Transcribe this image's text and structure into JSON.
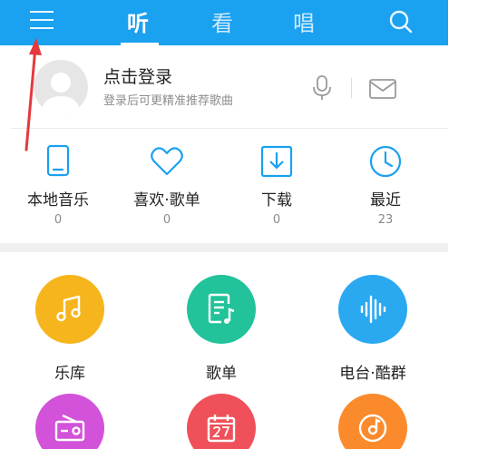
{
  "header": {
    "tabs": [
      {
        "label": "听",
        "active": true
      },
      {
        "label": "看",
        "active": false
      },
      {
        "label": "唱",
        "active": false
      }
    ],
    "menu_icon": "menu-icon",
    "search_icon": "search-icon",
    "bg_color": "#1aa1f0"
  },
  "profile": {
    "title": "点击登录",
    "subtitle": "登录后可更精准推荐歌曲",
    "avatar_icon": "avatar-placeholder-icon",
    "actions": [
      "microphone-icon",
      "mail-icon"
    ]
  },
  "stats": [
    {
      "label": "本地音乐",
      "count": "0",
      "icon": "phone-icon"
    },
    {
      "label": "喜欢·歌单",
      "count": "0",
      "icon": "heart-icon"
    },
    {
      "label": "下载",
      "count": "0",
      "icon": "download-icon"
    },
    {
      "label": "最近",
      "count": "23",
      "icon": "clock-icon"
    }
  ],
  "grid": [
    {
      "label": "乐库",
      "icon": "music-note-icon",
      "color": "#f7b51d"
    },
    {
      "label": "歌单",
      "icon": "playlist-icon",
      "color": "#22c29a"
    },
    {
      "label": "电台·酷群",
      "icon": "sound-wave-icon",
      "color": "#2aa9f1"
    },
    {
      "label": "",
      "icon": "radio-icon",
      "color": "#d252d9"
    },
    {
      "label": "",
      "icon": "calendar-icon",
      "color": "#f0505a"
    },
    {
      "label": "",
      "icon": "disc-icon",
      "color": "#fb8a2c"
    }
  ],
  "colors": {
    "accent": "#1aa1f0",
    "annotation_arrow": "#e4393c"
  }
}
